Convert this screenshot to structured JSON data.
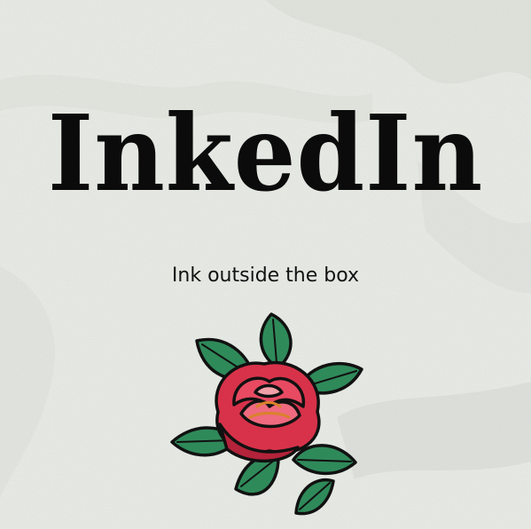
{
  "brand": {
    "name": "InkedIn",
    "tagline": "Ink outside the box"
  },
  "colors": {
    "background": "#e9ece6",
    "text": "#0b0b0b",
    "rose": "#d8324a",
    "leaf": "#2f8a5a"
  },
  "icons": {
    "illustration": "rose-tattoo-icon"
  }
}
